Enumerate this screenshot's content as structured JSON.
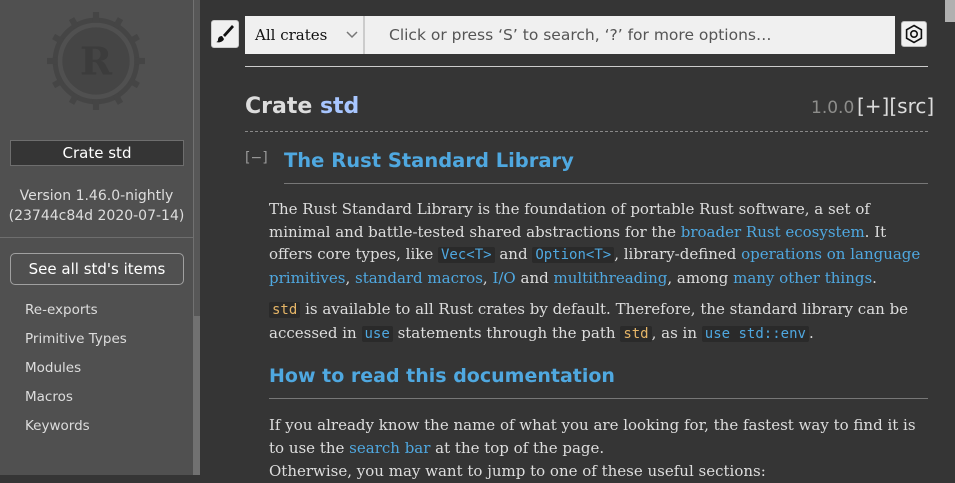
{
  "sidebar": {
    "crate_label": "Crate std",
    "version_line1": "Version 1.46.0-nightly",
    "version_line2": "(23744c84d 2020-07-14)",
    "see_all": "See all std's items",
    "items": [
      {
        "label": "Re-exports"
      },
      {
        "label": "Primitive Types"
      },
      {
        "label": "Modules"
      },
      {
        "label": "Macros"
      },
      {
        "label": "Keywords"
      }
    ]
  },
  "search": {
    "crate_filter": "All crates",
    "placeholder": "Click or press ‘S’ to search, ‘?’ for more options…"
  },
  "header": {
    "kind": "Crate ",
    "name": "std",
    "since": "1.0.0",
    "links": "[+][src]"
  },
  "doc": {
    "toggle": "[−]",
    "title": "The Rust Standard Library",
    "p1": {
      "t1": "The Rust Standard Library is the foundation of portable Rust software, a set of minimal and battle-tested shared abstractions for the ",
      "l1": "broader Rust ecosystem",
      "t2": ". It offers core types, like ",
      "c1": "Vec<T>",
      "t3": " and ",
      "c2": "Option<T>",
      "t4": ", library-defined ",
      "l2": "operations on language primitives",
      "t5": ", ",
      "l3": "standard macros",
      "t6": ", ",
      "l4": "I/O",
      "t7": " and ",
      "l5": "multithreading",
      "t8": ", among ",
      "l6": "many other things",
      "t9": "."
    },
    "p2": {
      "c1": "std",
      "t1": " is available to all Rust crates by default. Therefore, the standard library can be accessed in ",
      "c2": "use",
      "t2": " statements through the path ",
      "c3": "std",
      "t3": ", as in ",
      "c4": "use std::env",
      "t4": "."
    },
    "h2": "How to read this documentation",
    "p3": {
      "t1": "If you already know the name of what you are looking for, the fastest way to find it is to use the ",
      "l1": "search bar",
      "t2": " at the top of the page."
    },
    "p4": "Otherwise, you may want to jump to one of these useful sections:"
  },
  "colors": {
    "background": "#353535",
    "sidebar": "#505050",
    "link": "#4fa8e0",
    "crate_name": "#a8c6ff",
    "code_std": "#e5b567"
  }
}
